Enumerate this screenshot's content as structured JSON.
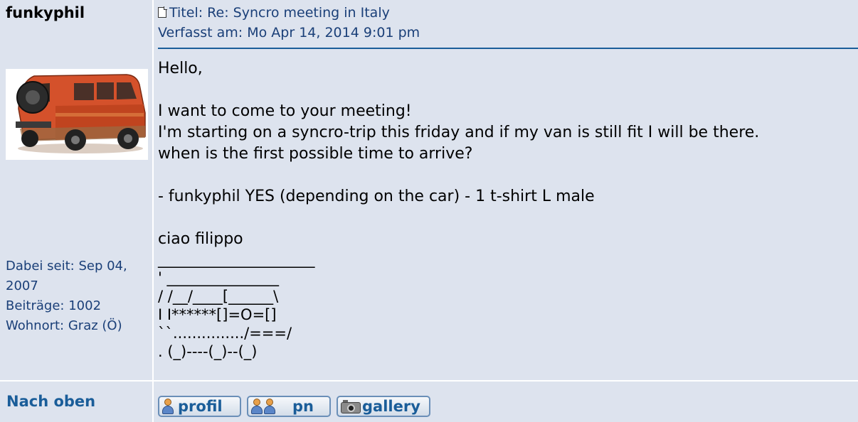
{
  "user": {
    "name": "funkyphil",
    "joined_label": "Dabei seit:",
    "joined_value": "Sep 04,",
    "joined_year": "2007",
    "posts_label": "Beiträge:",
    "posts_value": "1002",
    "location_label": "Wohnort:",
    "location_value": "Graz (Ö)"
  },
  "post": {
    "title_label": "Titel:",
    "title": "Re: Syncro meeting in Italy",
    "date_label": "Verfasst am:",
    "date": "Mo Apr 14, 2014 9:01 pm",
    "body": [
      "Hello,",
      "",
      "I want to come to your meeting!",
      "I'm starting on a syncro-trip this friday and if my van is still fit I will be there.",
      "when is the first possible time to arrive?",
      "",
      "- funkyphil YES (depending on the car) - 1 t-shirt L male",
      "",
      "ciao filippo"
    ],
    "signature": [
      "_____________________",
      "' _______________",
      "/ /__/____[______\\",
      "I I******[]=O=[]",
      "``.............../===/",
      ". (_)----(_)--(_)"
    ]
  },
  "footer": {
    "top_link": "Nach oben",
    "profil_label": "profil",
    "pn_label": "pn",
    "gallery_label": "gallery"
  },
  "icons": {
    "title": "document-icon",
    "avatar": "van-avatar",
    "profil": "person-icon",
    "pn": "two-persons-icon",
    "gallery": "camera-icon"
  },
  "colors": {
    "background": "#dde3ee",
    "link": "#1a5d99",
    "info_text": "#1a3f78"
  }
}
